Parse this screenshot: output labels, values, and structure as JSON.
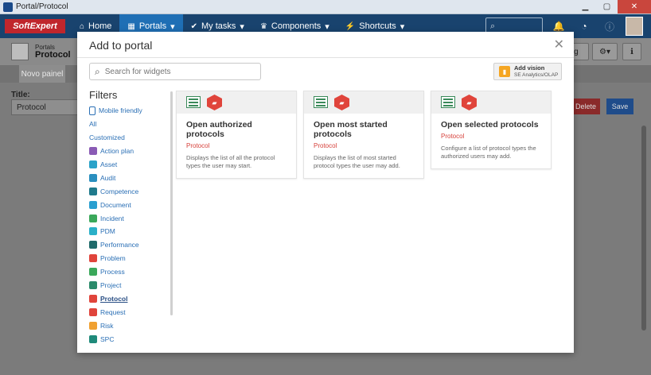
{
  "window": {
    "title": "Portal/Protocol",
    "controls": [
      "minimize",
      "maximize",
      "close"
    ]
  },
  "appbar": {
    "logo": "SoftExpert",
    "nav": [
      {
        "label": "Home",
        "icon": "home-icon",
        "glyph": "⌂"
      },
      {
        "label": "Portals",
        "icon": "portals-icon",
        "glyph": "▦",
        "caret": "▾"
      },
      {
        "label": "My tasks",
        "icon": "check-icon",
        "glyph": "✔",
        "caret": "▾"
      },
      {
        "label": "Components",
        "icon": "trophy-icon",
        "glyph": "♛",
        "caret": "▾"
      },
      {
        "label": "Shortcuts",
        "icon": "bolt-icon",
        "glyph": "⚡",
        "caret": "▾"
      }
    ]
  },
  "background_page": {
    "breadcrumb_small": "Portals",
    "breadcrumb_title": "Protocol",
    "config_btn": "ing",
    "tab_label": "Novo painel",
    "title_label": "Title:",
    "title_value": "Protocol",
    "delete_label": "Delete",
    "save_label": "Save"
  },
  "modal": {
    "title": "Add to portal",
    "search_placeholder": "Search for widgets",
    "add_vision_label": "Add vision",
    "add_vision_sub": "SE Analytics/OLAP",
    "filters_title": "Filters",
    "filters": [
      {
        "label": "Mobile friendly",
        "icon": "mobile-icon",
        "color": "#ffffff",
        "border": "#2a6fb5"
      },
      {
        "label": "All",
        "icon": "",
        "color": ""
      },
      {
        "label": "Customized",
        "icon": "",
        "color": ""
      },
      {
        "label": "Action plan",
        "icon": "action-plan-icon",
        "color": "#8a5bb5"
      },
      {
        "label": "Asset",
        "icon": "asset-icon",
        "color": "#2aa2c8"
      },
      {
        "label": "Audit",
        "icon": "audit-icon",
        "color": "#2a8fbf"
      },
      {
        "label": "Competence",
        "icon": "competence-icon",
        "color": "#1f7a8c"
      },
      {
        "label": "Document",
        "icon": "document-icon",
        "color": "#2a9fd0"
      },
      {
        "label": "Incident",
        "icon": "incident-icon",
        "color": "#3aa85a"
      },
      {
        "label": "PDM",
        "icon": "pdm-icon",
        "color": "#2ab0c8"
      },
      {
        "label": "Performance",
        "icon": "performance-icon",
        "color": "#1f6a6a"
      },
      {
        "label": "Problem",
        "icon": "problem-icon",
        "color": "#e0443b"
      },
      {
        "label": "Process",
        "icon": "process-icon",
        "color": "#3aa85a"
      },
      {
        "label": "Project",
        "icon": "project-icon",
        "color": "#2a8a6a"
      },
      {
        "label": "Protocol",
        "icon": "protocol-icon",
        "color": "#e0443b",
        "selected": true
      },
      {
        "label": "Request",
        "icon": "request-icon",
        "color": "#e0443b"
      },
      {
        "label": "Risk",
        "icon": "risk-icon",
        "color": "#f0a030"
      },
      {
        "label": "SPC",
        "icon": "spc-icon",
        "color": "#1f8a7a"
      }
    ],
    "cards": [
      {
        "title": "Open authorized protocols",
        "module": "Protocol",
        "description": "Displays the list of all the protocol types the user may start."
      },
      {
        "title": "Open most started protocols",
        "module": "Protocol",
        "description": "Displays the list of most started protocol types the user may add."
      },
      {
        "title": "Open selected protocols",
        "module": "Protocol",
        "description": "Configure a list of protocol types the authorized users may add."
      }
    ]
  }
}
